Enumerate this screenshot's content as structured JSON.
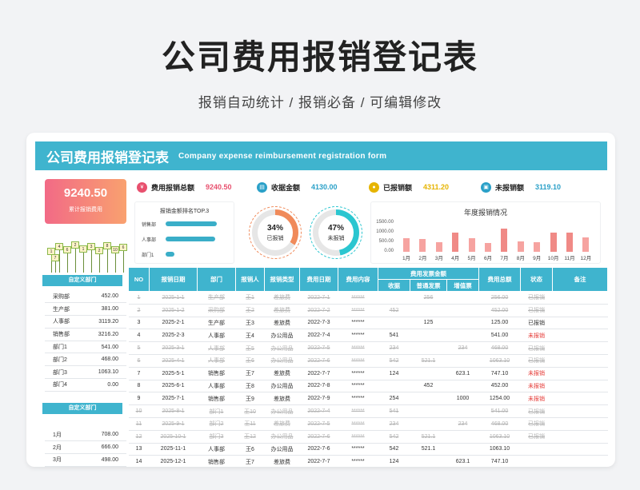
{
  "header": {
    "title": "公司费用报销登记表",
    "subtitle": "报销自动统计 / 报销必备  /  可编辑修改"
  },
  "banner": {
    "title": "公司费用报销登记表",
    "english": "Company expense reimbursement registration form"
  },
  "total_card": {
    "value": "9240.50",
    "label": "累计报销费用"
  },
  "deco_signs": [
    "1",
    "4",
    "6",
    "2",
    "1",
    "3",
    "2",
    "8",
    "10",
    "6",
    "7"
  ],
  "dept_ribbon": "自定义部门",
  "dept_table": [
    [
      "采购部",
      "452.00"
    ],
    [
      "生产部",
      "381.00"
    ],
    [
      "人事部",
      "3119.20"
    ],
    [
      "销售部",
      "3216.20"
    ],
    [
      "部门1",
      "541.00"
    ],
    [
      "部门2",
      "468.00"
    ],
    [
      "部门3",
      "1063.10"
    ],
    [
      "部门4",
      "0.00"
    ]
  ],
  "month_ribbon": "自定义部门",
  "month_table": [
    [
      "1月",
      "708.00"
    ],
    [
      "2月",
      "666.00"
    ],
    [
      "3月",
      "498.00"
    ]
  ],
  "kpis": [
    {
      "label": "费用报销总额",
      "value": "9240.50",
      "color": "#e8506e",
      "icon": "money-icon"
    },
    {
      "label": "收据金额",
      "value": "4130.00",
      "color": "#2aa0c8",
      "icon": "receipt-icon"
    },
    {
      "label": "已报销额",
      "value": "4311.20",
      "color": "#e6b400",
      "icon": "coin-icon"
    },
    {
      "label": "未报销额",
      "value": "3119.10",
      "color": "#2aa0c8",
      "icon": "pending-icon"
    }
  ],
  "top3": {
    "title": "报销金额排名TOP.3",
    "items": [
      {
        "name": "销售部",
        "value": 3216.2
      },
      {
        "name": "人事部",
        "value": 3119.2
      },
      {
        "name": "部门1",
        "value": 541.0
      }
    ]
  },
  "donuts": [
    {
      "pct": "34%",
      "label": "已报销",
      "fraction": 0.34,
      "color": "#f08a5a"
    },
    {
      "pct": "47%",
      "label": "未报销",
      "fraction": 0.47,
      "color": "#2bc6d0"
    }
  ],
  "chart_data": {
    "type": "bar",
    "title": "年度报销情况",
    "categories": [
      "1月",
      "2月",
      "3月",
      "4月",
      "5月",
      "6月",
      "7月",
      "8月",
      "9月",
      "10月",
      "11月",
      "12月"
    ],
    "values": [
      708,
      666,
      498,
      1010,
      720,
      470,
      1200,
      560,
      510,
      1020,
      1010,
      760
    ],
    "yticks": [
      "1500.00",
      "1000.00",
      "500.00",
      "0.00"
    ],
    "ylim": [
      0,
      1500
    ]
  },
  "table": {
    "headers": [
      "NO",
      "报销日期",
      "部门",
      "报销人",
      "报销类型",
      "费用日期",
      "费用内容",
      "费用发票金额",
      "费用总额",
      "状态",
      "备注"
    ],
    "subheaders": [
      "收据",
      "普通发票",
      "增值票"
    ],
    "rows": [
      {
        "void": true,
        "cells": [
          "1",
          "2025-1-1",
          "生产部",
          "王1",
          "差旅费",
          "2022-7-1",
          "******",
          "",
          "256",
          "",
          "256.00",
          "已报销",
          ""
        ]
      },
      {
        "void": true,
        "cells": [
          "2",
          "2025-1-2",
          "采购部",
          "王2",
          "差旅费",
          "2022-7-2",
          "******",
          "452",
          "",
          "",
          "452.00",
          "已报销",
          ""
        ]
      },
      {
        "void": false,
        "cells": [
          "3",
          "2025-2-1",
          "生产部",
          "王3",
          "差旅费",
          "2022-7-3",
          "******",
          "",
          "125",
          "",
          "125.00",
          "已报销",
          ""
        ]
      },
      {
        "void": false,
        "cells": [
          "4",
          "2025-2-3",
          "人事部",
          "王4",
          "办公用品",
          "2022-7-4",
          "******",
          "541",
          "",
          "",
          "541.00",
          "未报销",
          ""
        ]
      },
      {
        "void": true,
        "cells": [
          "5",
          "2025-3-1",
          "人事部",
          "王5",
          "办公用品",
          "2022-7-5",
          "******",
          "234",
          "",
          "234",
          "468.00",
          "已报销",
          ""
        ]
      },
      {
        "void": true,
        "cells": [
          "6",
          "2025-4-1",
          "人事部",
          "王6",
          "办公用品",
          "2022-7-6",
          "******",
          "542",
          "521.1",
          "",
          "1063.10",
          "已报销",
          ""
        ]
      },
      {
        "void": false,
        "cells": [
          "7",
          "2025-5-1",
          "销售部",
          "王7",
          "差旅费",
          "2022-7-7",
          "******",
          "124",
          "",
          "623.1",
          "747.10",
          "未报销",
          ""
        ]
      },
      {
        "void": false,
        "cells": [
          "8",
          "2025-6-1",
          "人事部",
          "王8",
          "办公用品",
          "2022-7-8",
          "******",
          "",
          "452",
          "",
          "452.00",
          "未报销",
          ""
        ]
      },
      {
        "void": false,
        "cells": [
          "9",
          "2025-7-1",
          "销售部",
          "王9",
          "差旅费",
          "2022-7-9",
          "******",
          "254",
          "",
          "1000",
          "1254.00",
          "未报销",
          ""
        ]
      },
      {
        "void": true,
        "cells": [
          "10",
          "2025-8-1",
          "部门1",
          "王10",
          "办公用品",
          "2022-7-4",
          "******",
          "541",
          "",
          "",
          "541.00",
          "已报销",
          ""
        ]
      },
      {
        "void": true,
        "cells": [
          "11",
          "2025-9-1",
          "部门2",
          "王11",
          "差旅费",
          "2022-7-5",
          "******",
          "234",
          "",
          "234",
          "468.00",
          "已报销",
          ""
        ]
      },
      {
        "void": true,
        "cells": [
          "12",
          "2025-10-1",
          "部门3",
          "王12",
          "办公用品",
          "2022-7-6",
          "******",
          "542",
          "521.1",
          "",
          "1063.10",
          "已报销",
          ""
        ]
      },
      {
        "void": false,
        "cells": [
          "13",
          "2025-11-1",
          "人事部",
          "王6",
          "办公用品",
          "2022-7-6",
          "******",
          "542",
          "521.1",
          "",
          "1063.10",
          "",
          ""
        ]
      },
      {
        "void": false,
        "cells": [
          "14",
          "2025-12-1",
          "销售部",
          "王7",
          "差旅费",
          "2022-7-7",
          "******",
          "124",
          "",
          "623.1",
          "747.10",
          "",
          ""
        ]
      }
    ]
  }
}
